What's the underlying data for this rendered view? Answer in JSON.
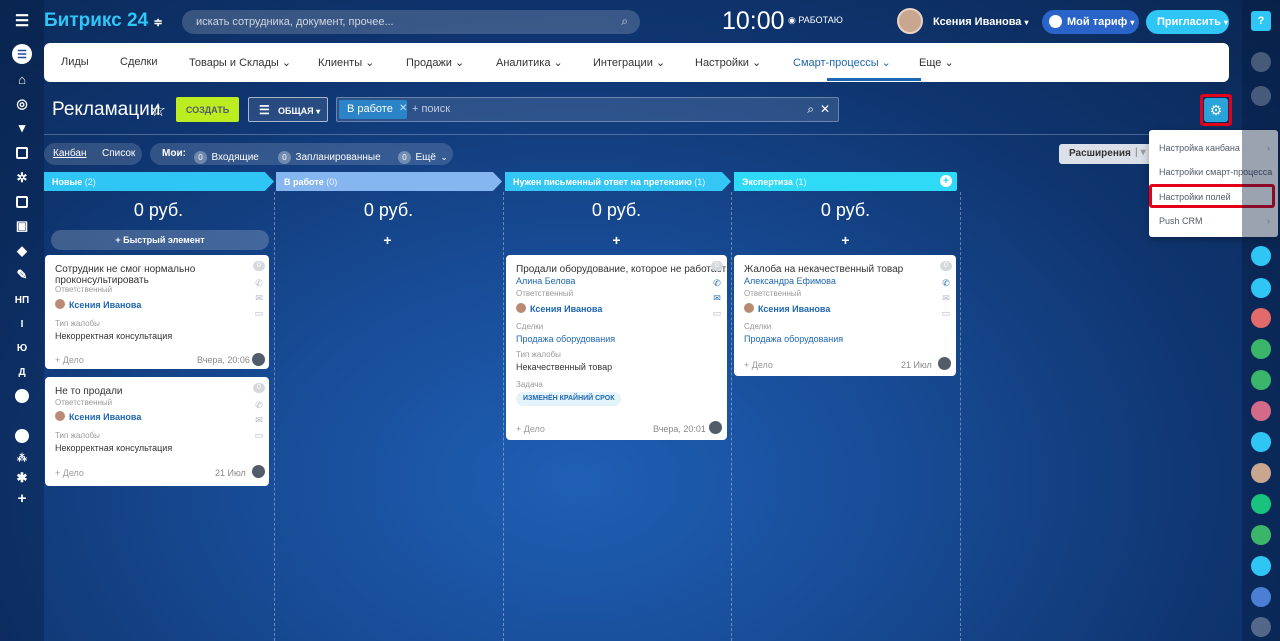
{
  "app": {
    "logo_text": "Битрикс",
    "logo_num": "24"
  },
  "header": {
    "search_placeholder": "искать сотрудника, документ, прочее...",
    "time": "10:00",
    "work_status": "РАБОТАЮ",
    "user_name": "Ксения Иванова",
    "plan_button": "Мой тариф",
    "invite_button": "Пригласить"
  },
  "nav": {
    "items": [
      "Лиды",
      "Сделки",
      "Товары и Склады",
      "Клиенты",
      "Продажи",
      "Аналитика",
      "Интеграции",
      "Настройки",
      "Смарт-процессы",
      "Еще"
    ]
  },
  "page": {
    "title": "Рекламации",
    "create_button": "СОЗДАТЬ",
    "common_button": "ОБЩАЯ",
    "filter_chip": "В работе",
    "filter_placeholder": "+ поиск"
  },
  "view": {
    "kanban": "Канбан",
    "list": "Список",
    "my_label": "Мои:",
    "incoming_count": "0",
    "incoming": "Входящие",
    "planned_count": "0",
    "planned": "Запланированные",
    "more_count": "0",
    "more": "Ещё",
    "extensions": "Расширения"
  },
  "columns": [
    {
      "name": "Новые",
      "count": "(2)",
      "sum": "0 руб.",
      "color": "#2fc6f6"
    },
    {
      "name": "В работе",
      "count": "(0)",
      "sum": "0 руб.",
      "color": "#86b6f0"
    },
    {
      "name": "Нужен письменный ответ на претензию",
      "count": "(1)",
      "sum": "0 руб.",
      "color": "#34c6f4"
    },
    {
      "name": "Экспертиза",
      "count": "(1)",
      "sum": "0 руб.",
      "color": "#2fdaf6"
    }
  ],
  "quick_element": "Быстрый элемент",
  "cards": [
    {
      "title_l1": "Сотрудник не смог нормально",
      "title_l2": "проконсультировать",
      "badge": "0",
      "resp_label": "Ответственный",
      "resp": "Ксения Иванова",
      "type_label": "Тип жалобы",
      "type": "Некорректная консультация",
      "delo": "+ Дело",
      "date": "Вчера, 20:06"
    },
    {
      "title_l1": "Не то продали",
      "badge": "0",
      "resp_label": "Ответственный",
      "resp": "Ксения Иванова",
      "type_label": "Тип жалобы",
      "type": "Некорректная консультация",
      "delo": "+ Дело",
      "date": "21 Июл"
    },
    {
      "title_l1": "Продали оборудование, которое не работает",
      "client": "Алина Белова",
      "badge": "0",
      "resp_label": "Ответственный",
      "resp": "Ксения Иванова",
      "deals_label": "Сделки",
      "deal": "Продажа оборудования",
      "type_label": "Тип жалобы",
      "type": "Некачественный товар",
      "task_label": "Задача",
      "tag": "ИЗМЕНЁН КРАЙНИЙ СРОК",
      "delo": "+ Дело",
      "date": "Вчера, 20:01"
    },
    {
      "title_l1": "Жалоба на некачественный товар",
      "client": "Александра Ефимова",
      "badge": "0",
      "resp_label": "Ответственный",
      "resp": "Ксения Иванова",
      "deals_label": "Сделки",
      "deal": "Продажа оборудования",
      "delo": "+ Дело",
      "date": "21 Июл"
    }
  ],
  "menu": {
    "items": [
      "Настройка канбана",
      "Настройки смарт-процесса",
      "Настройки полей",
      "Push CRM"
    ]
  },
  "left_rail": {
    "letters": [
      "НП",
      "I",
      "Ю",
      "Д"
    ]
  },
  "colors": {
    "accent": "#2fc6f6",
    "create": "#bbed21",
    "highlight": "#e3001b",
    "link": "#2067b0"
  }
}
